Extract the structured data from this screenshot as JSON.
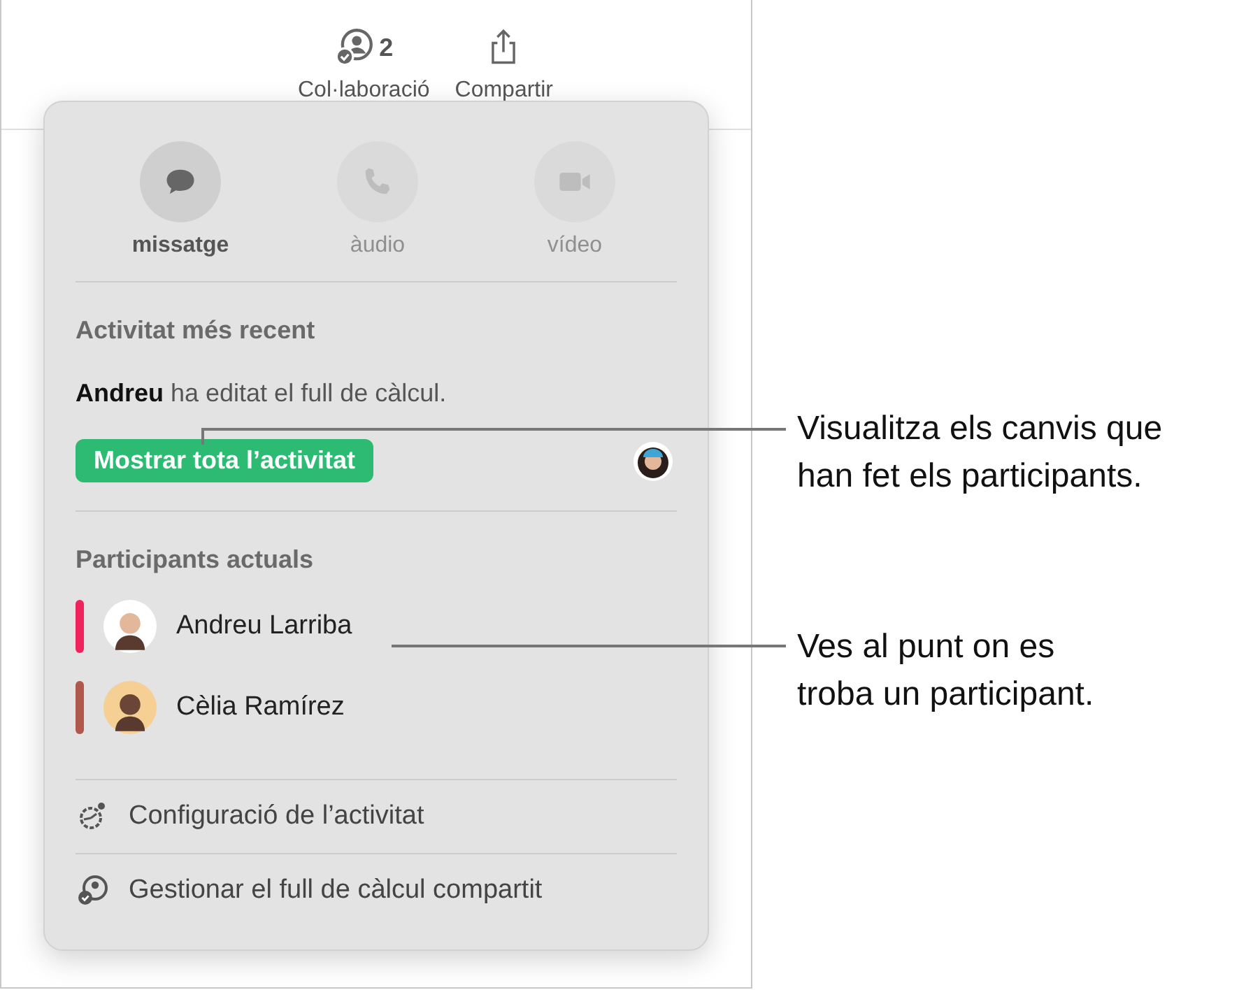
{
  "toolbar": {
    "collaboration": {
      "label": "Col·laboració",
      "count": "2"
    },
    "share": {
      "label": "Compartir"
    }
  },
  "popover": {
    "actions": [
      {
        "label": "missatge",
        "kind": "message",
        "disabled": false
      },
      {
        "label": "àudio",
        "kind": "audio",
        "disabled": true
      },
      {
        "label": "vídeo",
        "kind": "video",
        "disabled": true
      }
    ],
    "recent": {
      "heading": "Activitat més recent",
      "activity": "**Andreu** ha editat el full de càlcul.",
      "button": "Mostrar tota l’activitat"
    },
    "participants": {
      "heading": "Participants actuals",
      "items": [
        {
          "name": "Andreu Larriba",
          "color": "#f0245a"
        },
        {
          "name": "Cèlia Ramírez",
          "color": "#b0584b"
        }
      ]
    },
    "menu": [
      {
        "label": "Configuració de l’activitat",
        "kind": "settings"
      },
      {
        "label": "Gestionar el full de càlcul compartit",
        "kind": "manage"
      }
    ]
  },
  "callouts": [
    "Visualitza els canvis que\nhan fet els participants.",
    "Ves al punt on es\ntroba un participant."
  ]
}
